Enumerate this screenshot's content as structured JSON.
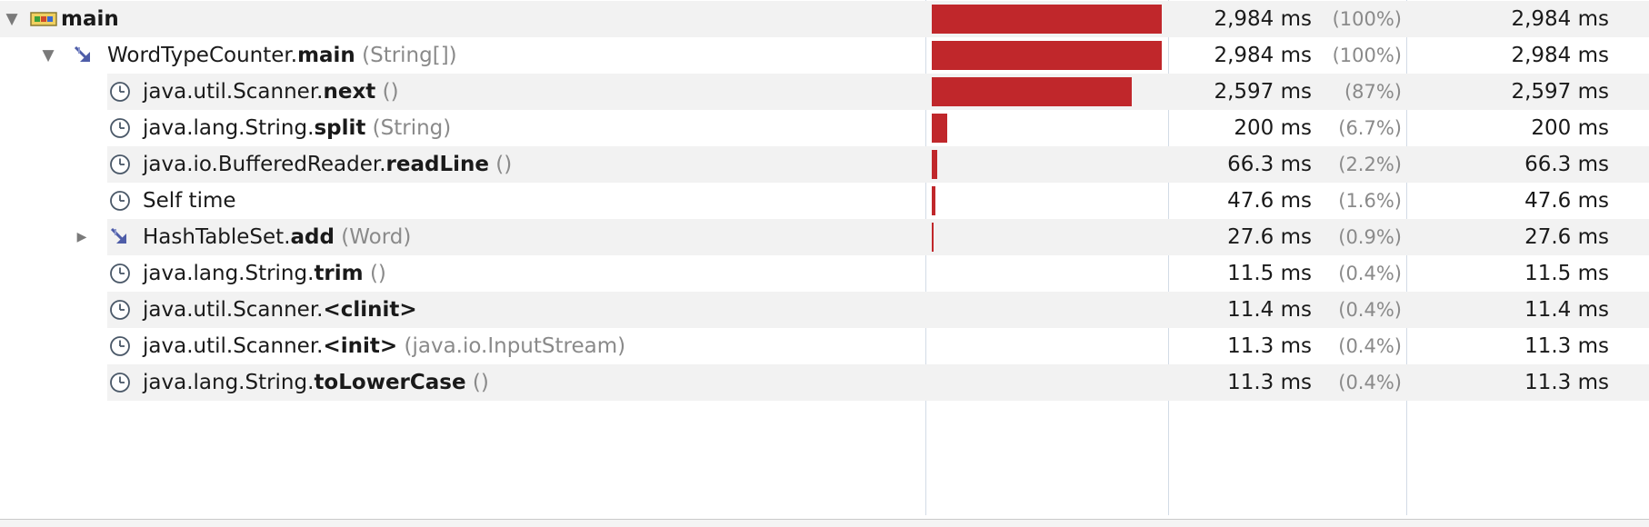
{
  "tree": {
    "rows": [
      {
        "toggle": "▼",
        "icon": "thread-icon",
        "cls": "",
        "method": "main",
        "args": "",
        "time": "2,984 ms",
        "pct": "(100%)",
        "own": "2,984 ms",
        "fraction": 1.0
      },
      {
        "toggle": "▼",
        "icon": "method-call-arrow-icon",
        "cls": "WordTypeCounter.",
        "method": "main",
        "args": "(String[])",
        "time": "2,984 ms",
        "pct": "(100%)",
        "own": "2,984 ms",
        "fraction": 1.0
      },
      {
        "toggle": "",
        "icon": "clock-icon",
        "cls": "java.util.Scanner.",
        "method": "next",
        "args": "()",
        "time": "2,597 ms",
        "pct": "(87%)",
        "own": "2,597 ms",
        "fraction": 0.87
      },
      {
        "toggle": "",
        "icon": "clock-icon",
        "cls": "java.lang.String.",
        "method": "split",
        "args": "(String)",
        "time": "200 ms",
        "pct": "(6.7%)",
        "own": "200 ms",
        "fraction": 0.067
      },
      {
        "toggle": "",
        "icon": "clock-icon",
        "cls": "java.io.BufferedReader.",
        "method": "readLine",
        "args": "()",
        "time": "66.3 ms",
        "pct": "(2.2%)",
        "own": "66.3 ms",
        "fraction": 0.022
      },
      {
        "toggle": "",
        "icon": "clock-icon",
        "cls": "Self time",
        "method": "",
        "args": "",
        "time": "47.6 ms",
        "pct": "(1.6%)",
        "own": "47.6 ms",
        "fraction": 0.016
      },
      {
        "toggle": "▶",
        "icon": "method-call-arrow-icon",
        "cls": "HashTableSet.",
        "method": "add",
        "args": "(Word)",
        "time": "27.6 ms",
        "pct": "(0.9%)",
        "own": "27.6 ms",
        "fraction": 0.009
      },
      {
        "toggle": "",
        "icon": "clock-icon",
        "cls": "java.lang.String.",
        "method": "trim",
        "args": "()",
        "time": "11.5 ms",
        "pct": "(0.4%)",
        "own": "11.5 ms",
        "fraction": 0.004
      },
      {
        "toggle": "",
        "icon": "clock-icon",
        "cls": "java.util.Scanner.",
        "method": "<clinit>",
        "args": "",
        "time": "11.4 ms",
        "pct": "(0.4%)",
        "own": "11.4 ms",
        "fraction": 0.004
      },
      {
        "toggle": "",
        "icon": "clock-icon",
        "cls": "java.util.Scanner.",
        "method": "<init>",
        "args": "(java.io.InputStream)",
        "time": "11.3 ms",
        "pct": "(0.4%)",
        "own": "11.3 ms",
        "fraction": 0.004
      },
      {
        "toggle": "",
        "icon": "clock-icon",
        "cls": "java.lang.String.",
        "method": "toLowerCase",
        "args": "()",
        "time": "11.3 ms",
        "pct": "(0.4%)",
        "own": "11.3 ms",
        "fraction": 0.004
      }
    ]
  },
  "colors": {
    "bar": "#c0272b",
    "row_alt": "#f2f2f2",
    "column_divider": "#d3dbe6"
  }
}
